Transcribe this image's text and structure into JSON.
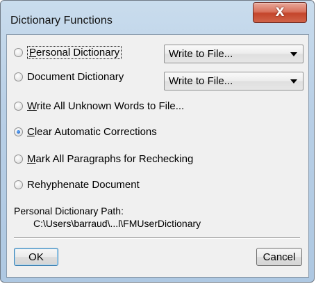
{
  "window": {
    "title": "Dictionary Functions",
    "close_label": "X"
  },
  "options": [
    {
      "label": "Personal Dictionary",
      "checked": false
    },
    {
      "label": "Document Dictionary",
      "checked": false
    },
    {
      "label": "Write All Unknown Words to File...",
      "checked": false
    },
    {
      "label": "Clear Automatic Corrections",
      "checked": true
    },
    {
      "label": "Mark All Paragraphs for Rechecking",
      "checked": false
    },
    {
      "label": "Rehyphenate Document",
      "checked": false
    }
  ],
  "selects": {
    "personal": {
      "value": "Write to File..."
    },
    "document": {
      "value": "Write to File..."
    }
  },
  "path": {
    "label": "Personal Dictionary Path:",
    "value": "C:\\Users\\barraud\\...l\\FMUserDictionary"
  },
  "buttons": {
    "ok": "OK",
    "cancel": "Cancel"
  }
}
